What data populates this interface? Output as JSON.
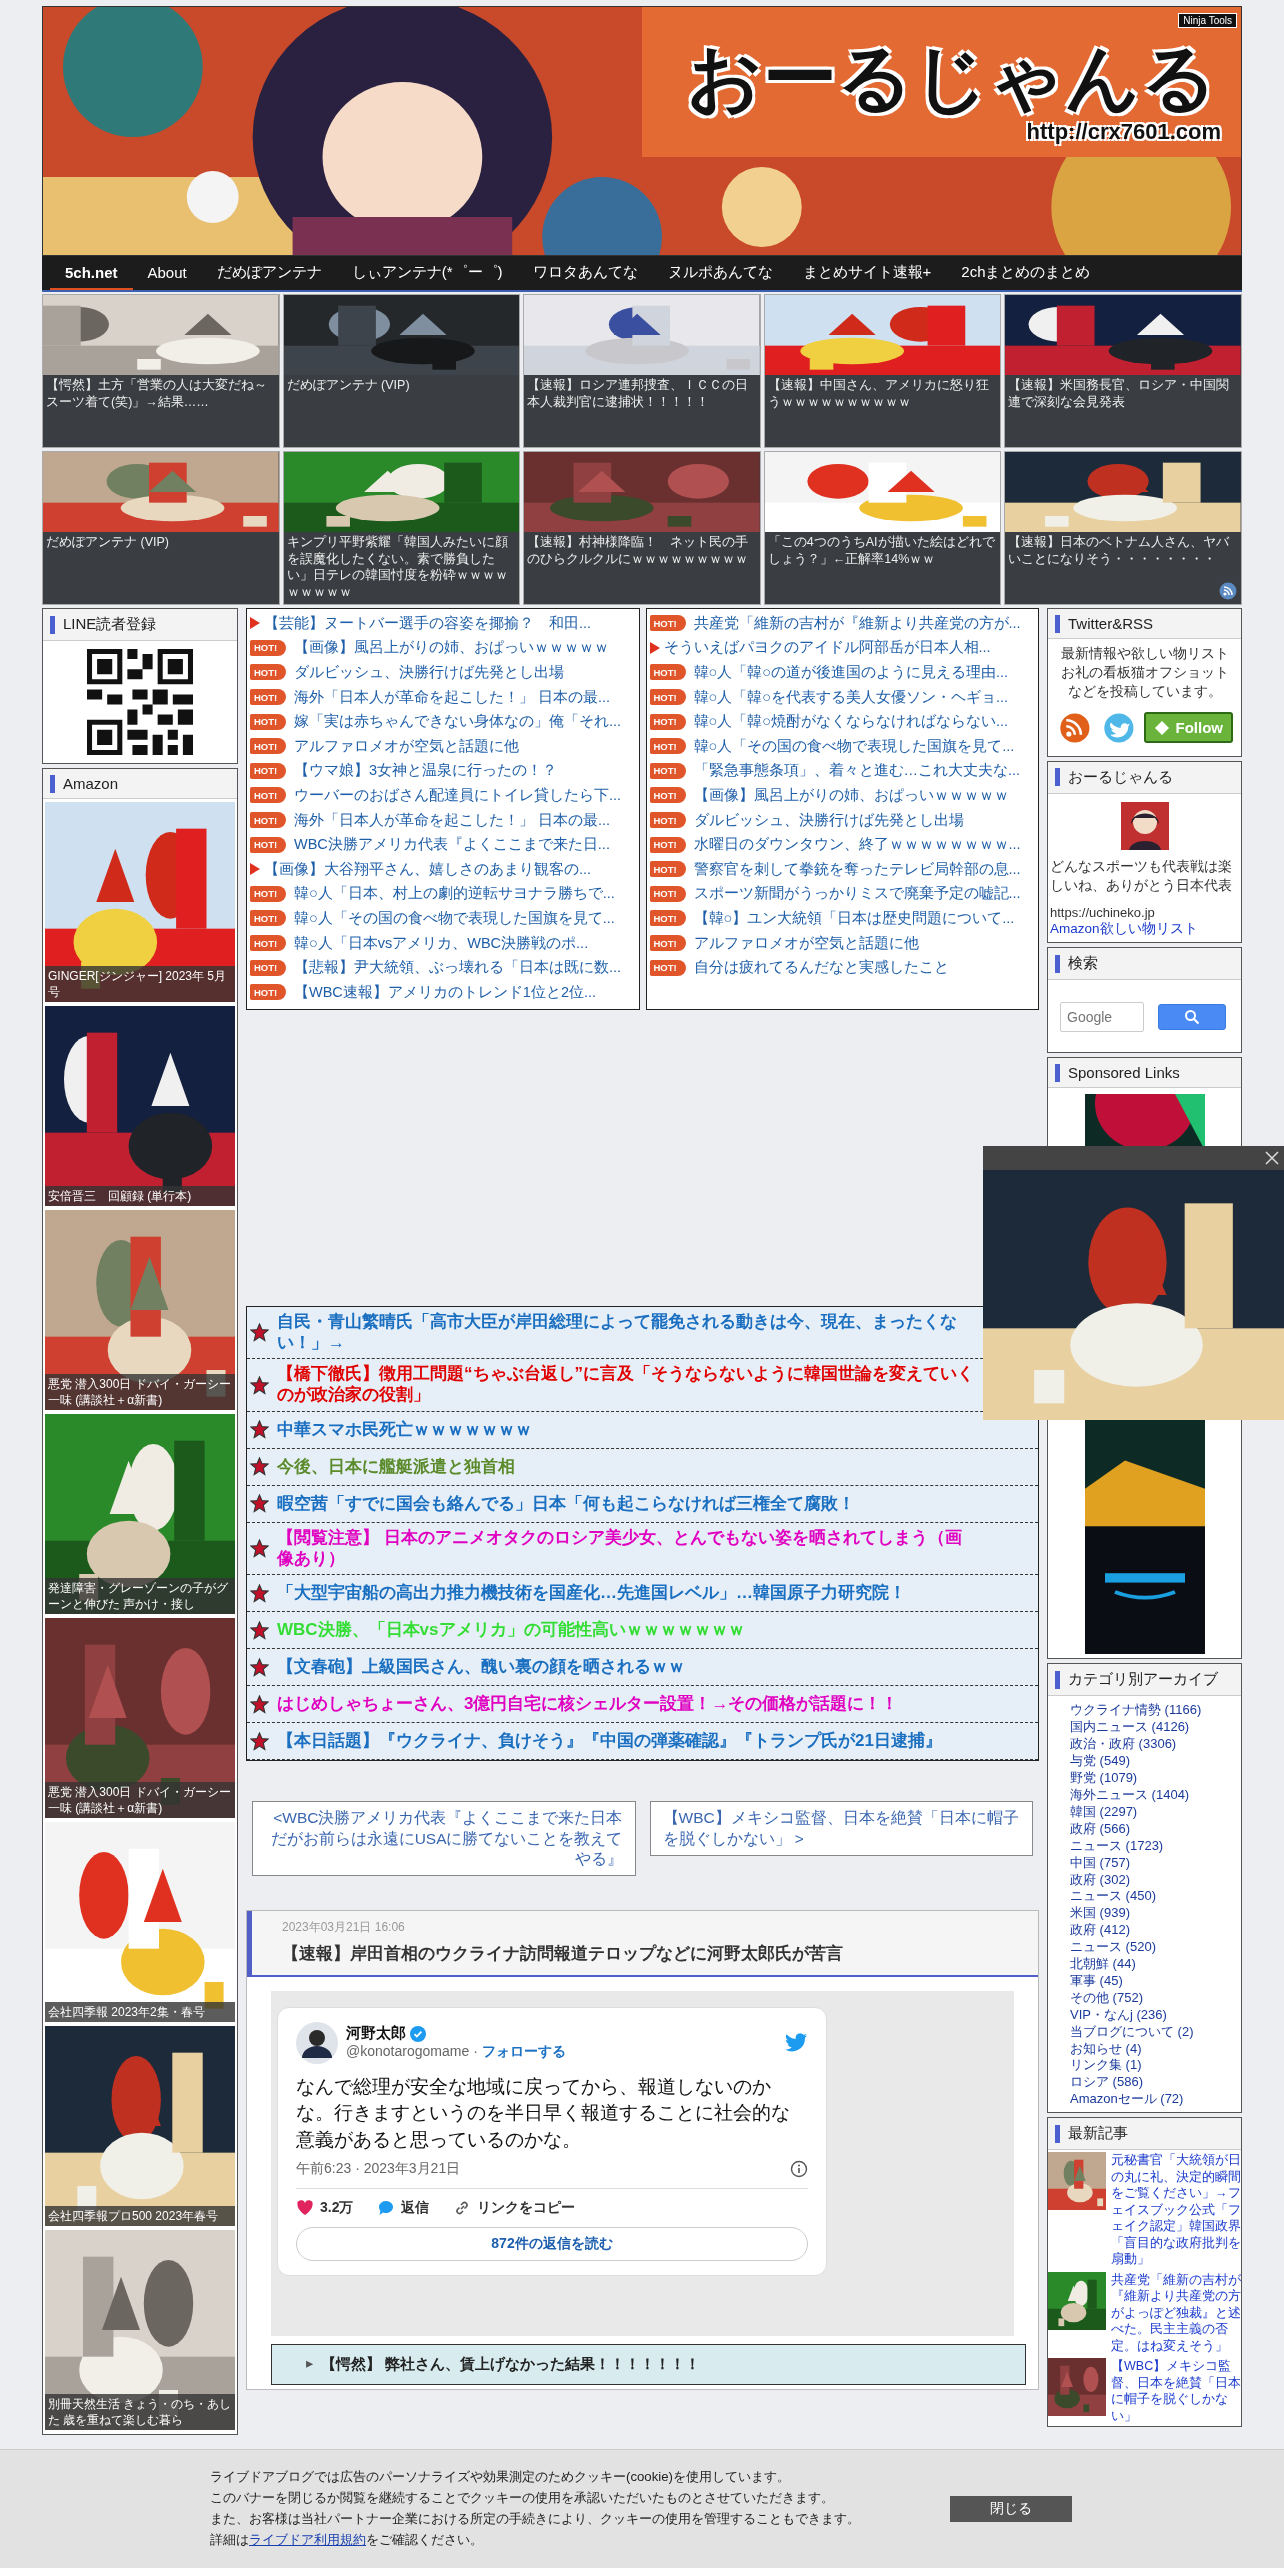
{
  "header": {
    "title": "おーるじゃんる",
    "url": "http://crx7601.com",
    "badge": "Ninja Tools"
  },
  "nav": [
    {
      "label": "5ch.net",
      "selected": true
    },
    {
      "label": "About",
      "selected": false
    },
    {
      "label": "だめぽアンテナ",
      "selected": false
    },
    {
      "label": "しぃアンテナ(*゜ー゜)",
      "selected": false
    },
    {
      "label": "ワロタあんてな",
      "selected": false
    },
    {
      "label": "ヌルポあんてな",
      "selected": false
    },
    {
      "label": "まとめサイト速報+",
      "selected": false
    },
    {
      "label": "2chまとめのまとめ",
      "selected": false
    }
  ],
  "featured": [
    {
      "caption": "【愕然】土方「営業の人は大変だね～スーツ着て(笑)」→結果……"
    },
    {
      "caption": "だめぽアンテナ (VIP)"
    },
    {
      "caption": "【速報】ロシア連邦捜査、ＩＣＣの日本人裁判官に逮捕状！！！！！"
    },
    {
      "caption": "【速報】中国さん、アメリカに怒り狂うｗｗｗｗｗｗｗｗｗｗ"
    },
    {
      "caption": "【速報】米国務長官、ロシア・中国関連で深刻な会見発表"
    },
    {
      "caption": "だめぽアンテナ (VIP)"
    },
    {
      "caption": "キンプリ平野紫耀「韓国人みたいに顔を誤魔化したくない。素で勝負したい」日テレの韓国忖度を粉砕ｗｗｗｗｗｗｗｗｗ"
    },
    {
      "caption": "【速報】村神様降臨！　ネット民の手のひらクルクルにｗｗｗｗｗｗｗｗｗ"
    },
    {
      "caption": "「この4つのうちAIが描いた絵はどれでしょう？」←正解率14%ｗｗ"
    },
    {
      "caption": "【速報】日本のベトナム人さん、ヤバいことになりそう・・・・・・・・"
    }
  ],
  "left_sidebar": {
    "line_title": "LINE読者登録",
    "amazon_title": "Amazon",
    "books": [
      {
        "caption": "GINGER[ジンジャー] 2023年 5月号"
      },
      {
        "caption": "安倍晋三　回顧録 (単行本)"
      },
      {
        "caption": "悪党 潜入300日 ドバイ・ガーシー一味 (講談社＋α新書)"
      },
      {
        "caption": "発達障害・グレーゾーンの子がグーンと伸びた 声かけ・接し"
      },
      {
        "caption": "悪党 潜入300日 ドバイ・ガーシー一味 (講談社＋α新書)"
      },
      {
        "caption": "会社四季報 2023年2集・春号"
      },
      {
        "caption": "会社四季報プロ500 2023年春号"
      },
      {
        "caption": "別冊天然生活 きょう・のち・あした 歳を重ねて楽しむ暮ら"
      }
    ]
  },
  "link_lists": [
    {
      "items": [
        {
          "kind": "arrow",
          "text": "【芸能】ヌートバー選手の容姿を揶揄？　和田..."
        },
        {
          "kind": "hot",
          "badge": "HOT!",
          "text": "【画像】風呂上がりの姉、おぱっいｗｗｗｗｗ"
        },
        {
          "kind": "hot",
          "badge": "HOT!",
          "text": "ダルビッシュ、決勝行けば先発とし出場"
        },
        {
          "kind": "hot",
          "badge": "HOT!",
          "text": "海外「日本人が革命を起こした！」 日本の最..."
        },
        {
          "kind": "hot",
          "badge": "HOT!",
          "text": "嫁「実は赤ちゃんできない身体なの」俺「それ..."
        },
        {
          "kind": "hot",
          "badge": "HOT!",
          "text": "アルファロメオが空気と話題に他"
        },
        {
          "kind": "hot",
          "badge": "HOT!",
          "text": "【ウマ娘】3女神と温泉に行ったの！？"
        },
        {
          "kind": "hot",
          "badge": "HOT!",
          "text": "ウーバーのおばさん配達員にトイレ貸したら下..."
        },
        {
          "kind": "hot",
          "badge": "HOT!",
          "text": "海外「日本人が革命を起こした！」 日本の最..."
        },
        {
          "kind": "hot",
          "badge": "HOT!",
          "text": "WBC決勝アメリカ代表『よくここまで来た日..."
        },
        {
          "kind": "arrow",
          "text": "【画像】大谷翔平さん、嬉しさのあまり観客の..."
        },
        {
          "kind": "hot",
          "badge": "HOT!",
          "text": "韓○人「日本、村上の劇的逆転サヨナラ勝ちで..."
        },
        {
          "kind": "hot",
          "badge": "HOT!",
          "text": "韓○人「その国の食べ物で表現した国旗を見て..."
        },
        {
          "kind": "hot",
          "badge": "HOT!",
          "text": "韓○人「日本vsアメリカ、WBC決勝戦のポ..."
        },
        {
          "kind": "hot",
          "badge": "HOT!",
          "text": "【悲報】尹大統領、ぶっ壊れる「日本は既に数..."
        },
        {
          "kind": "hot",
          "badge": "HOT!",
          "text": "【WBC速報】アメリカのトレンド1位と2位..."
        }
      ]
    },
    {
      "items": [
        {
          "kind": "hot",
          "badge": "HOT!",
          "text": "共産党「維新の吉村が『維新より共産党の方が..."
        },
        {
          "kind": "arrow",
          "text": "そういえばパヨクのアイドル阿部岳が日本人相..."
        },
        {
          "kind": "hot",
          "badge": "HOT!",
          "text": "韓○人「韓○の道が後進国のように見える理由..."
        },
        {
          "kind": "hot",
          "badge": "HOT!",
          "text": "韓○人「韓○を代表する美人女優ソン・ヘギョ..."
        },
        {
          "kind": "hot",
          "badge": "HOT!",
          "text": "韓○人「韓○焼酎がなくならなければならない..."
        },
        {
          "kind": "hot",
          "badge": "HOT!",
          "text": "韓○人「その国の食べ物で表現した国旗を見て..."
        },
        {
          "kind": "hot",
          "badge": "HOT!",
          "text": "「緊急事態条項」、着々と進む…これ大丈夫な..."
        },
        {
          "kind": "hot",
          "badge": "HOT!",
          "text": "【画像】風呂上がりの姉、おぱっいｗｗｗｗｗ"
        },
        {
          "kind": "hot",
          "badge": "HOT!",
          "text": "ダルビッシュ、決勝行けば先発とし出場"
        },
        {
          "kind": "hot",
          "badge": "HOT!",
          "text": "水曜日のダウンタウン、終了ｗｗｗｗｗｗｗｗ..."
        },
        {
          "kind": "hot",
          "badge": "HOT!",
          "text": "警察官を刺して拳銃を奪ったテレビ局幹部の息..."
        },
        {
          "kind": "hot",
          "badge": "HOT!",
          "text": "スポーツ新聞がうっかりミスで廃棄予定の嘘記..."
        },
        {
          "kind": "hot",
          "badge": "HOT!",
          "text": "【韓○】ユン大統領「日本は歴史問題について..."
        },
        {
          "kind": "hot",
          "badge": "HOT!",
          "text": "アルファロメオが空気と話題に他"
        },
        {
          "kind": "hot",
          "badge": "HOT!",
          "text": "自分は疲れてるんだなと実感したこと"
        }
      ]
    }
  ],
  "pickup": [
    {
      "text": "自民・青山繁晴氏「高市大臣が岸田総理によって罷免される動きは今、現在、まったくない！」→",
      "color": "#1a6fc0"
    },
    {
      "text": "【橋下徹氏】徴用工問題“ちゃぶ台返し”に言及「そうならないように韓国世論を変えていくのが政治家の役割」",
      "color": "#e00000"
    },
    {
      "text": "中華スマホ民死亡ｗｗｗｗｗｗｗ",
      "color": "#1a6fc0"
    },
    {
      "text": "今後、日本に艦艇派遣と独首相",
      "color": "#5a8a2a"
    },
    {
      "text": "暇空茜「すでに国会も絡んでる」日本「何も起こらなければ三権全て腐敗！",
      "color": "#1a6fc0"
    },
    {
      "text": "【閲覧注意】 日本のアニメオタクのロシア美少女、とんでもない姿を晒されてしまう（画像あり）",
      "color": "#e000c0"
    },
    {
      "text": "「大型宇宙船の高出力推力機技術を国産化…先進国レベル」…韓国原子力研究院！",
      "color": "#1a6fc0"
    },
    {
      "text": "WBC決勝、「日本vsアメリカ」の可能性高いｗｗｗｗｗｗｗ",
      "color": "#33dd33"
    },
    {
      "text": "【文春砲】上級国民さん、醜い裏の顔を晒されるｗｗ",
      "color": "#1a6fc0"
    },
    {
      "text": "はじめしゃちょーさん、3億円自宅に核シェルター設置！→その価格が話題に！！",
      "color": "#e000c0"
    },
    {
      "text": "【本日話題】『ウクライナ、負けそう』『中国の弾薬確認』『トランプ氏が21日逮捕』",
      "color": "#1a6fc0"
    }
  ],
  "pager": {
    "prev": "<WBC決勝アメリカ代表『よくここまで来た日本だがお前らは永遠にUSAに勝てないことを教えてやる』",
    "next": "【WBC】メキシコ監督、日本を絶賛「日本に帽子を脱ぐしかない」 >"
  },
  "article": {
    "date": "2023年03月21日 16:06",
    "title": "【速報】岸田首相のウクライナ訪問報道テロップなどに河野太郎氏が苦言",
    "tweet": {
      "name": "河野太郎",
      "handle": "@konotarogomame",
      "separator": "·",
      "follow": "フォローする",
      "body": "なんで総理が安全な地域に戻ってから、報道しないのかな。行きますというのを半日早く報道することに社会的な意義があると思っているのかな。",
      "time": "午前6:23 · 2023年3月21日",
      "likes": "3.2万",
      "reply": "返信",
      "copy": "リンクをコピー",
      "read_replies": "872件の返信を読む"
    },
    "related": {
      "marker": "▸",
      "text": "【愕然】 弊社さん、賃上げなかった結果！！！！！！！"
    }
  },
  "right_sidebar": {
    "twitter": {
      "title": "Twitter&RSS",
      "text": "最新情報や欲しい物リストお礼の看板猫オフショットなどを投稿しています。",
      "follow": "Follow"
    },
    "profile": {
      "title": "おーるじゃんる",
      "text": "どんなスポーツも代表戦は楽しいね、ありがとう日本代表",
      "url": "https://uchineko.jp",
      "link": "Amazon欲しい物リスト"
    },
    "search": {
      "title": "検索",
      "placeholder": "Google"
    },
    "sponsored": {
      "title": "Sponsored Links"
    },
    "archive": {
      "title": "カテゴリ別アーカイブ",
      "items": [
        "ウクライナ情勢 (1166)",
        "国内ニュース (4126)",
        "政治・政府 (3306)",
        "与党 (549)",
        "野党 (1079)",
        "海外ニュース (1404)",
        "韓国 (2297)",
        "政府 (566)",
        "ニュース (1723)",
        "中国 (757)",
        "政府 (302)",
        "ニュース (450)",
        "米国 (939)",
        "政府 (412)",
        "ニュース (520)",
        "北朝鮮 (44)",
        "軍事 (45)",
        "その他 (752)",
        "VIP・なんj (236)",
        "当ブログについて (2)",
        "お知らせ (4)",
        "リンク集 (1)",
        "ロシア (586)",
        "Amazonセール (72)"
      ]
    },
    "latest": {
      "title": "最新記事",
      "items": [
        "元秘書官「大統領が日の丸に礼、決定的瞬間をご覧ください」→フェイスブック公式「フェイク認定」韓国政界「盲目的な政府批判を扇動」",
        "共産党「維新の吉村が『維新より共産党の方がよっぽど独裁』と述べた。民主主義の否定。はね変えそう」",
        "【WBC】メキシコ監督、日本を絶賛「日本に帽子を脱ぐしかない」"
      ]
    }
  },
  "cookie_banner": {
    "lines": [
      "ライブドアブログでは広告のパーソナライズや効果測定のためクッキー(cookie)を使用しています。",
      "このバナーを閉じるか閲覧を継続することでクッキーの使用を承認いただいたものとさせていただきます。",
      "また、お客様は当社パートナー企業における所定の手続きにより、クッキーの使用を管理することもできます。"
    ],
    "last_before": "詳細は",
    "link": "ライブドア利用規約",
    "last_after": "をご確認ください。",
    "close": "閉じる"
  }
}
